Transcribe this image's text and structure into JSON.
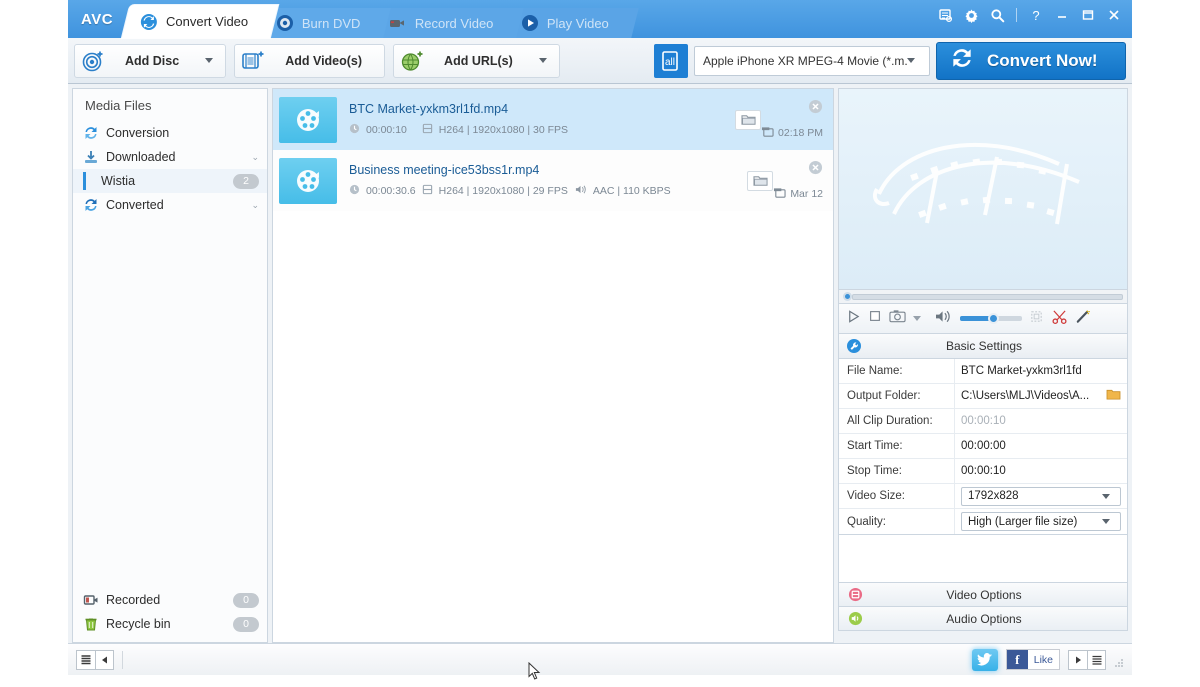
{
  "app": {
    "logo": "AVC"
  },
  "titlebar": {
    "tabs": [
      {
        "label": "Convert Video",
        "icon": "convert-icon",
        "active": true
      },
      {
        "label": "Burn DVD",
        "icon": "disc-icon",
        "active": false
      },
      {
        "label": "Record Video",
        "icon": "camcorder-icon",
        "active": false
      },
      {
        "label": "Play Video",
        "icon": "play-icon",
        "active": false
      }
    ],
    "window_buttons": [
      {
        "name": "menu-list-icon",
        "glyph": "▤"
      },
      {
        "name": "settings-gear-icon",
        "glyph": "⚙"
      },
      {
        "name": "search-icon",
        "glyph": "🔍"
      },
      {
        "name": "help-icon",
        "glyph": "?"
      },
      {
        "name": "minimize-button",
        "glyph": "—"
      },
      {
        "name": "maximize-button",
        "glyph": "▭"
      },
      {
        "name": "close-button",
        "glyph": "✕"
      }
    ]
  },
  "toolbar": {
    "add_disc": "Add Disc",
    "add_videos": "Add Video(s)",
    "add_urls": "Add URL(s)",
    "preset": "Apple iPhone XR MPEG-4 Movie (*.m...",
    "convert": "Convert Now!"
  },
  "sidebar": {
    "title": "Media Files",
    "items": [
      {
        "label": "Conversion",
        "icon": "conversion-icon",
        "badge": null,
        "chevron": false,
        "selected": false,
        "sub": false
      },
      {
        "label": "Downloaded",
        "icon": "downloaded-icon",
        "badge": null,
        "chevron": true,
        "selected": false,
        "sub": false
      },
      {
        "label": "Wistia",
        "icon": null,
        "badge": "2",
        "chevron": false,
        "selected": true,
        "sub": true
      },
      {
        "label": "Converted",
        "icon": "converted-icon",
        "badge": null,
        "chevron": true,
        "selected": false,
        "sub": false
      }
    ],
    "bottom_items": [
      {
        "label": "Recorded",
        "icon": "recorded-icon",
        "badge": "0"
      },
      {
        "label": "Recycle bin",
        "icon": "recycle-bin-icon",
        "badge": "0"
      }
    ]
  },
  "filelist": {
    "rows": [
      {
        "name": "BTC Market-yxkm3rl1fd.mp4",
        "duration": "00:00:10",
        "video": "H264 | 1920x1080 | 30 FPS",
        "audio": "",
        "stamp": "02:18 PM",
        "selected": true
      },
      {
        "name": "Business meeting-ice53bss1r.mp4",
        "duration": "00:00:30.6",
        "video": "H264 | 1920x1080 | 29 FPS",
        "audio": "AAC | 110 KBPS",
        "stamp": "Mar 12",
        "selected": false
      }
    ]
  },
  "preview": {
    "watermark": "film-strip-watermark"
  },
  "player": {
    "buttons": [
      {
        "name": "play-button",
        "glyph": "▷"
      },
      {
        "name": "stop-button",
        "glyph": "▢"
      },
      {
        "name": "snapshot-button",
        "glyph": "⌾"
      },
      {
        "name": "snapshot-dropdown",
        "glyph": "▾"
      },
      {
        "name": "volume-icon",
        "glyph": "🔊"
      },
      {
        "name": "crop-button",
        "glyph": "⛶"
      },
      {
        "name": "trim-scissors-button",
        "glyph": "✂"
      },
      {
        "name": "effects-wand-button",
        "glyph": "✎"
      }
    ]
  },
  "settings": {
    "header": "Basic Settings",
    "rows": [
      {
        "key": "File Name:",
        "value": "BTC Market-yxkm3rl1fd",
        "type": "text",
        "dim": false,
        "folder": false
      },
      {
        "key": "Output Folder:",
        "value": "C:\\Users\\MLJ\\Videos\\A...",
        "type": "text",
        "dim": false,
        "folder": true
      },
      {
        "key": "All Clip Duration:",
        "value": "00:00:10",
        "type": "text",
        "dim": true,
        "folder": false
      },
      {
        "key": "Start Time:",
        "value": "00:00:00",
        "type": "text",
        "dim": false,
        "folder": false
      },
      {
        "key": "Stop Time:",
        "value": "00:00:10",
        "type": "text",
        "dim": false,
        "folder": false
      },
      {
        "key": "Video Size:",
        "value": "1792x828",
        "type": "select",
        "dim": false,
        "folder": false
      },
      {
        "key": "Quality:",
        "value": "High (Larger file size)",
        "type": "select",
        "dim": false,
        "folder": false
      }
    ],
    "video_options": "Video Options",
    "audio_options": "Audio Options"
  },
  "statusbar": {
    "facebook_like": "Like",
    "facebook_mark": "f"
  },
  "colors": {
    "accent_blue": "#2b8fdc",
    "title_blue": "#3f93de",
    "selected_row": "#cfe8fa",
    "link_text": "#1a5c96",
    "video_options_red": "#e8607f",
    "audio_options_green": "#8cc63f"
  }
}
